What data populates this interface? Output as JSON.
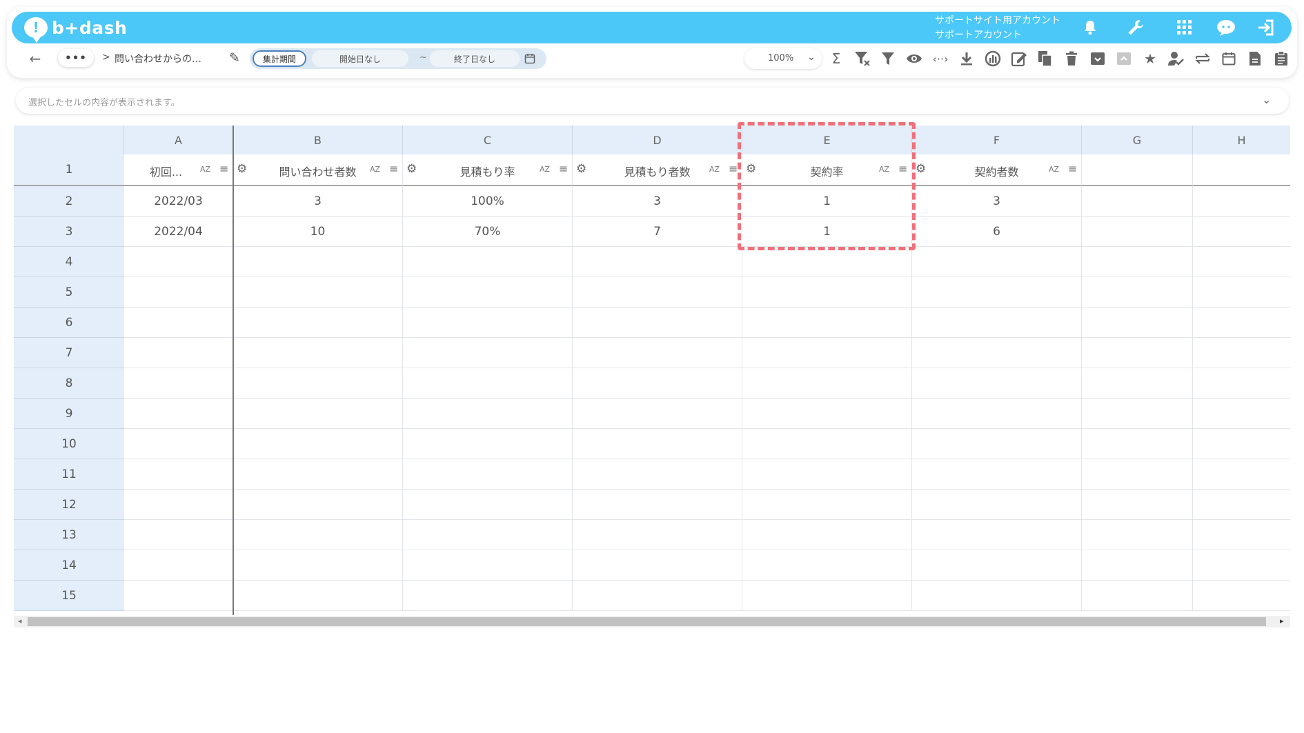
{
  "app": {
    "logo_text": "b+dash"
  },
  "account": {
    "line1": "サポートサイト用アカウント",
    "line2": "サポートアカウント"
  },
  "top_icons": [
    "bell-icon",
    "wrench-icon",
    "grid-icon",
    "chat-icon",
    "logout-icon"
  ],
  "breadcrumb": {
    "more_label": "•••",
    "separator": ">",
    "current": "問い合わせからの…"
  },
  "period": {
    "button_label": "集計期間",
    "start_placeholder": "開始日なし",
    "tilde": "~",
    "end_placeholder": "終了日なし"
  },
  "zoom": {
    "value": "100%"
  },
  "toolbar_icons": [
    "sigma-icon",
    "filter-clear-icon",
    "filter-icon",
    "eye-icon",
    "code-icon",
    "download-icon",
    "chart-icon",
    "edit-note-icon",
    "copy-icon",
    "trash-icon",
    "archive-icon",
    "unarchive-icon",
    "star-icon",
    "user-check-icon",
    "swap-icon",
    "calendar-icon",
    "document-icon",
    "clipboard-icon"
  ],
  "formula_bar": {
    "placeholder": "選択したセルの内容が表示されます。"
  },
  "sheet": {
    "columns": [
      "A",
      "B",
      "C",
      "D",
      "E",
      "F",
      "G",
      "H"
    ],
    "header_labels": [
      "初回...",
      "問い合わせ者数",
      "見積もり率",
      "見積もり者数",
      "契約率",
      "契約者数"
    ],
    "sort_label": "AZ",
    "rows": [
      "1",
      "2",
      "3",
      "4",
      "5",
      "6",
      "7",
      "8",
      "9",
      "10",
      "11",
      "12",
      "13",
      "14",
      "15"
    ],
    "data": [
      [
        "2022/03",
        "3",
        "100%",
        "3",
        "1",
        "3"
      ],
      [
        "2022/04",
        "10",
        "70%",
        "7",
        "1",
        "6"
      ]
    ]
  },
  "accent_colors": {
    "topbar": "#4cc8f8",
    "highlight": "#f0707a",
    "header_bg": "#e3eefa"
  }
}
